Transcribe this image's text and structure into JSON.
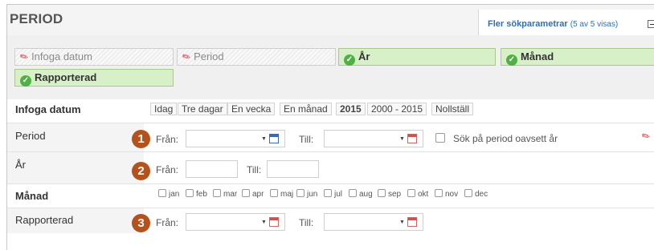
{
  "header": {
    "title": "PERIOD",
    "more_params_label": "Fler sökparametrar",
    "more_params_count": "(5 av 5 visas)"
  },
  "chips": [
    {
      "label": "Infoga datum",
      "state": "off"
    },
    {
      "label": "Period",
      "state": "off"
    },
    {
      "label": "År",
      "state": "on"
    },
    {
      "label": "Månad",
      "state": "on"
    },
    {
      "label": "Rapporterad",
      "state": "on"
    }
  ],
  "rows": {
    "infoga": {
      "label": "Infoga datum",
      "quick_buttons": [
        "Idag",
        "Tre dagar",
        "En vecka",
        "En månad",
        "2015",
        "2000 - 2015",
        "Nollställ"
      ]
    },
    "period": {
      "label": "Period",
      "badge": "1",
      "from_label": "Från:",
      "to_label": "Till:",
      "from_value": "",
      "to_value": "",
      "checkbox_label": "Sök på period oavsett år"
    },
    "ar": {
      "label": "År",
      "badge": "2",
      "from_label": "Från:",
      "to_label": "Till:",
      "from_value": "",
      "to_value": ""
    },
    "manad": {
      "label": "Månad",
      "months": [
        "jan",
        "feb",
        "mar",
        "apr",
        "maj",
        "jun",
        "jul",
        "aug",
        "sep",
        "okt",
        "nov",
        "dec"
      ]
    },
    "rapporterad": {
      "label": "Rapporterad",
      "badge": "3",
      "from_label": "Från:",
      "to_label": "Till:",
      "from_value": "",
      "to_value": ""
    }
  },
  "colors": {
    "badge": "#b5521b",
    "chip_active": "#d8f0c8",
    "link": "#2f6fb3",
    "pin": "#d8373f",
    "check": "#4fb043"
  },
  "icons": [
    "pin-icon",
    "check-icon",
    "calendar-icon",
    "collapse-icon"
  ]
}
